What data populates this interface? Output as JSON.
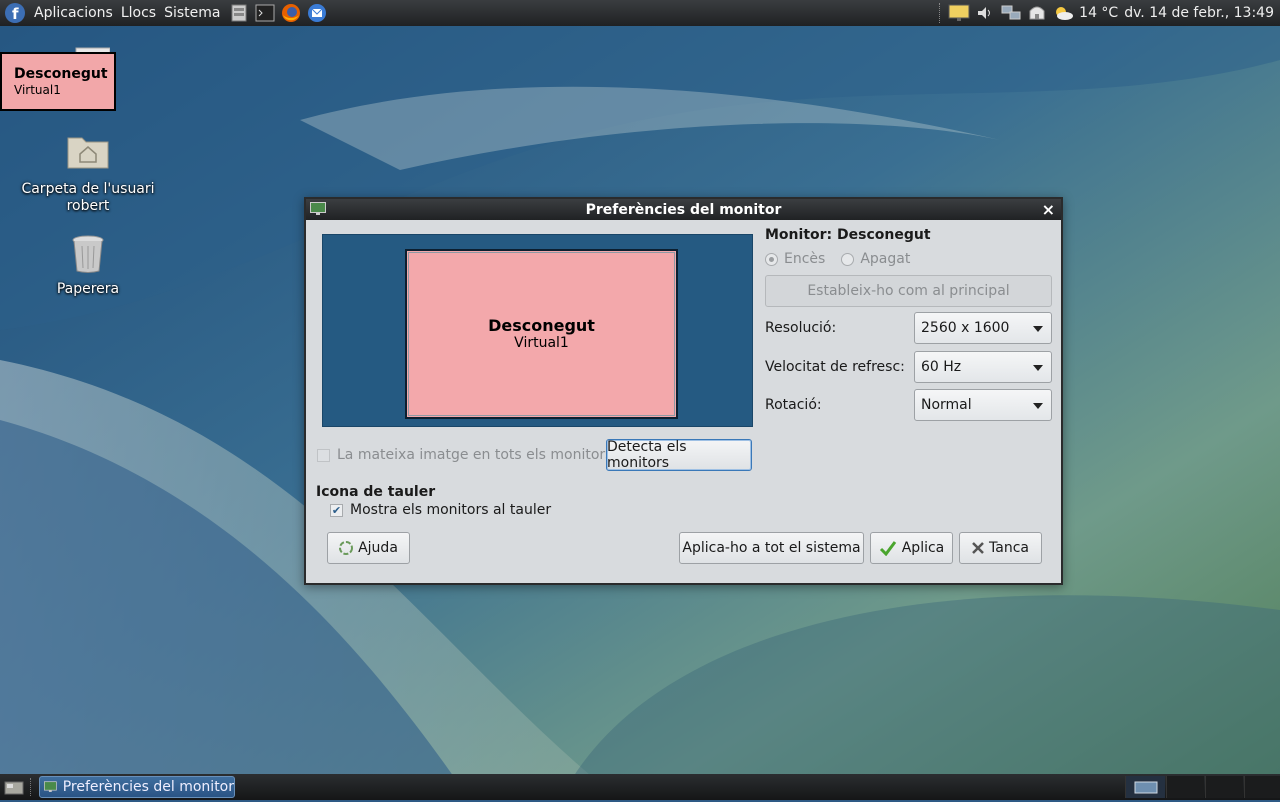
{
  "top_panel": {
    "menus": [
      "Aplicacions",
      "Llocs",
      "Sistema"
    ],
    "weather_temp": "14 °C",
    "clock": "dv. 14 de febr., 13:49"
  },
  "desktop": {
    "monitor_overlay": {
      "name": "Desconegut",
      "output": "Virtual1"
    },
    "icons": [
      {
        "label": "Carpeta de l'usuari robert"
      },
      {
        "label": "Paperera"
      }
    ]
  },
  "dialog": {
    "title": "Preferències del monitor",
    "preview": {
      "name": "Desconegut",
      "output": "Virtual1"
    },
    "monitor_heading": "Monitor: Desconegut",
    "on_label": "Encès",
    "off_label": "Apagat",
    "set_primary_label": "Estableix-ho com al principal",
    "resolution_label": "Resolució:",
    "resolution_value": "2560 x 1600",
    "refresh_label": "Velocitat de refresc:",
    "refresh_value": "60 Hz",
    "rotation_label": "Rotació:",
    "rotation_value": "Normal",
    "mirror_label": "La mateixa imatge en tots els monitors",
    "detect_label": "Detecta els monitors",
    "panel_icon_heading": "Icona de tauler",
    "show_in_panel_label": "Mostra els monitors al tauler",
    "help_label": "Ajuda",
    "apply_system_label": "Aplica-ho a tot el sistema",
    "apply_label": "Aplica",
    "close_label": "Tanca"
  },
  "bottom_panel": {
    "task_label": "Preferències del monitor"
  },
  "colors": {
    "monitor_pink": "#f3a8ab",
    "preview_bg": "#255a82",
    "dialog_bg": "#d8dbde"
  }
}
